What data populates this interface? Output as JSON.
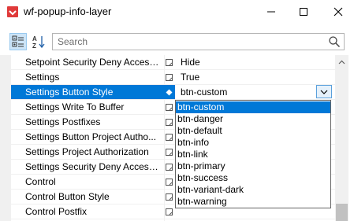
{
  "window": {
    "title": "wf-popup-info-layer"
  },
  "toolbar": {
    "search_placeholder": "Search"
  },
  "properties": [
    {
      "name": "Setpoint Security Deny Access...",
      "value": "Hide",
      "selected": false,
      "box": "edit"
    },
    {
      "name": "Settings",
      "value": "True",
      "selected": false,
      "box": "edit"
    },
    {
      "name": "Settings Button Style",
      "value": "btn-custom",
      "selected": true,
      "box": "diamond"
    },
    {
      "name": "Settings Write To Buffer",
      "value": "",
      "selected": false,
      "box": "edit"
    },
    {
      "name": "Settings Postfixes",
      "value": "",
      "selected": false,
      "box": "edit"
    },
    {
      "name": "Settings Button Project Autho...",
      "value": "",
      "selected": false,
      "box": "edit"
    },
    {
      "name": "Settings Project Authorization",
      "value": "",
      "selected": false,
      "box": "edit"
    },
    {
      "name": "Settings Security Deny Access ...",
      "value": "",
      "selected": false,
      "box": "edit"
    },
    {
      "name": "Control",
      "value": "",
      "selected": false,
      "box": "edit"
    },
    {
      "name": "Control Button Style",
      "value": "",
      "selected": false,
      "box": "edit"
    },
    {
      "name": "Control Postfix",
      "value": "",
      "selected": false,
      "box": "edit"
    }
  ],
  "dropdown": {
    "options": [
      "btn-custom",
      "btn-danger",
      "btn-default",
      "btn-info",
      "btn-link",
      "btn-primary",
      "btn-success",
      "btn-variant-dark",
      "btn-warning"
    ],
    "selected_index": 0
  },
  "colors": {
    "selection": "#0078d7",
    "grid_lines": "#f0f0f0"
  },
  "icons": {
    "app": "app-icon",
    "minimize": "minimize-icon",
    "maximize": "maximize-icon",
    "close": "close-icon",
    "categorized": "categorized-view-icon",
    "alphabetical": "sort-alphabetical-icon",
    "search": "search-icon",
    "dropdown": "chevron-down-icon"
  }
}
